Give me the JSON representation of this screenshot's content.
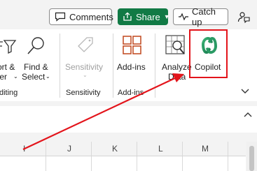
{
  "topbar": {
    "comments_label": "Comments",
    "share_label": "Share",
    "catchup_label": "Catch up"
  },
  "ribbon": {
    "partial_sort_top": "ort &",
    "partial_sort_bottom": "ter",
    "find_top": "Find &",
    "find_bottom": "Select",
    "sensitivity_label": "Sensitivity",
    "addins_label": "Add-ins",
    "analyze_top": "Analyze",
    "analyze_bottom": "Data",
    "copilot_label": "Copilot",
    "group_editing": "diting",
    "group_sensitivity": "Sensitivity",
    "group_addins": "Add-ins"
  },
  "grid": {
    "columns": [
      "I",
      "J",
      "K",
      "L",
      "M"
    ]
  },
  "colors": {
    "share_bg": "#117a45",
    "highlight": "#e3141b",
    "copilot_green": "#1a8a5a"
  }
}
